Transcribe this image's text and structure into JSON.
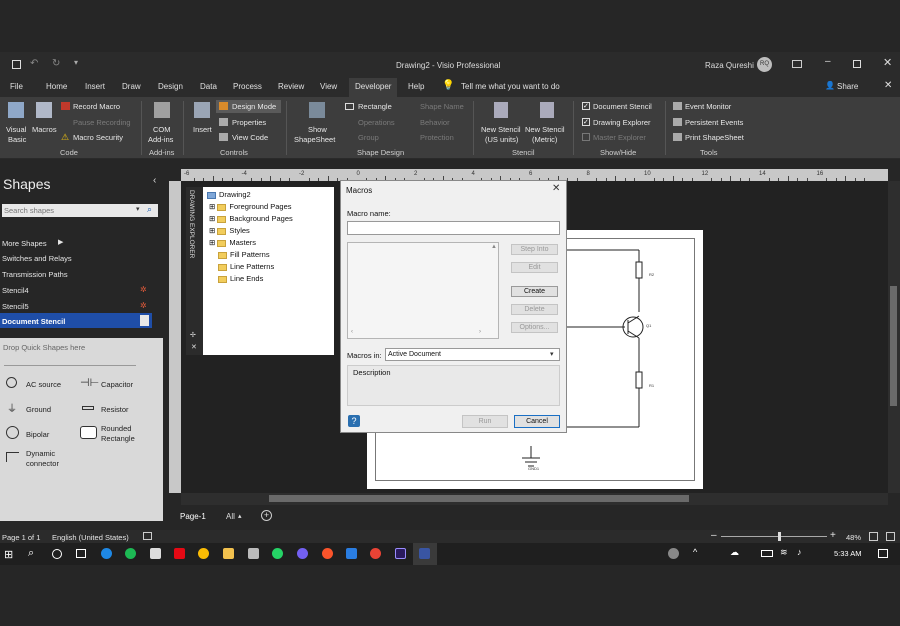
{
  "titlebar": {
    "doc_title": "Drawing2  -  Visio Professional",
    "user_name": "Raza Qureshi",
    "user_initials": "RQ"
  },
  "tabs": [
    "File",
    "Home",
    "Insert",
    "Draw",
    "Design",
    "Data",
    "Process",
    "Review",
    "View",
    "Developer",
    "Help"
  ],
  "tell_me": "Tell me what you want to do",
  "share_label": "Share",
  "ribbon": {
    "code": {
      "visual_basic": [
        "Visual",
        "Basic"
      ],
      "macros": "Macros",
      "record_macro": "Record Macro",
      "pause_recording": "Pause Recording",
      "macro_security": "Macro Security",
      "group": "Code"
    },
    "addins": {
      "com": [
        "COM",
        "Add-ins"
      ],
      "group": "Add-ins"
    },
    "controls": {
      "insert": "Insert",
      "design_mode": "Design Mode",
      "properties": "Properties",
      "view_code": "View Code",
      "group": "Controls"
    },
    "shape_design": {
      "show_shapesheet": [
        "Show",
        "ShapeSheet"
      ],
      "rectangle": "Rectangle",
      "shape_name": "Shape Name",
      "operations": "Operations",
      "behavior": "Behavior",
      "group_btn": "Group",
      "protection": "Protection",
      "group": "Shape Design"
    },
    "stencil": {
      "new_us": [
        "New Stencil",
        "(US units)"
      ],
      "new_metric": [
        "New Stencil",
        "(Metric)"
      ],
      "group": "Stencil"
    },
    "show_hide": {
      "document_stencil": "Document Stencil",
      "drawing_explorer": "Drawing Explorer",
      "master_explorer": "Master Explorer",
      "group": "Show/Hide"
    },
    "tools": {
      "event_monitor": "Event Monitor",
      "persistent_events": "Persistent Events",
      "print_shapesheet": "Print ShapeSheet",
      "group": "Tools"
    }
  },
  "shapes_pane": {
    "title": "Shapes",
    "search_placeholder": "Search shapes",
    "more_shapes": "More Shapes",
    "items": [
      "Switches and Relays",
      "Transmission Paths",
      "Stencil4",
      "Stencil5",
      "Document Stencil"
    ],
    "drop_hint": "Drop Quick Shapes here",
    "shapes": [
      "AC source",
      "Capacitor",
      "Ground",
      "Resistor",
      "Bipolar",
      "Rounded Rectangle",
      "Dynamic connector"
    ]
  },
  "explorer": {
    "vertical_title": "DRAWING EXPLORER",
    "root": "Drawing2",
    "nodes": [
      "Foreground Pages",
      "Background Pages",
      "Styles",
      "Masters",
      "Fill Patterns",
      "Line Patterns",
      "Line Ends"
    ]
  },
  "ruler_labels": [
    "-6",
    "-4",
    "-2",
    "0",
    "2",
    "4",
    "6",
    "8",
    "10",
    "12",
    "14",
    "16"
  ],
  "dialog": {
    "title": "Macros",
    "macro_name_label": "Macro name:",
    "buttons": [
      "Step Into",
      "Edit",
      "Create",
      "Delete",
      "Options..."
    ],
    "macros_in_label": "Macros in:",
    "macros_in_value": "Active Document",
    "description_label": "Description",
    "run": "Run",
    "cancel": "Cancel"
  },
  "schematic_labels": [
    "R2",
    "Q1",
    "R1",
    "GND1"
  ],
  "pagebar": {
    "page": "Page-1",
    "all": "All"
  },
  "status": {
    "page": "Page 1 of 1",
    "language": "English (United States)",
    "zoom": "48%"
  },
  "clock": "5:33 AM"
}
